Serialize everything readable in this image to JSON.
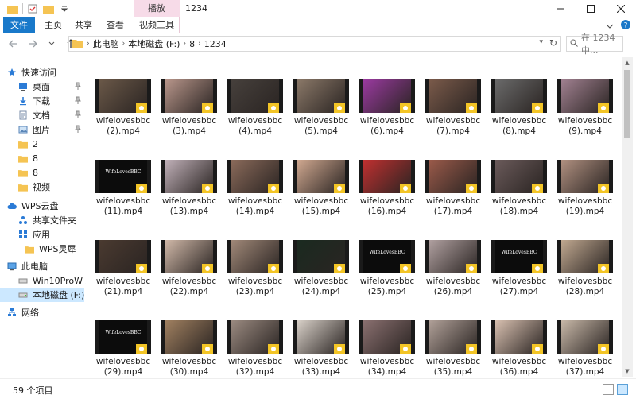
{
  "window": {
    "title": "1234",
    "context_tab": "播放"
  },
  "ribbon": {
    "tabs": [
      "文件",
      "主页",
      "共享",
      "查看",
      "视频工具"
    ]
  },
  "address": {
    "crumbs": [
      "此电脑",
      "本地磁盘 (F:)",
      "8",
      "1234"
    ],
    "search_placeholder": "在 1234 中..."
  },
  "sidebar": {
    "items": [
      {
        "label": "快速访问",
        "icon": "star-icon",
        "pinned": false
      },
      {
        "label": "桌面",
        "icon": "desktop-icon",
        "pinned": true
      },
      {
        "label": "下载",
        "icon": "download-icon",
        "pinned": true
      },
      {
        "label": "文档",
        "icon": "document-icon",
        "pinned": true
      },
      {
        "label": "图片",
        "icon": "pictures-icon",
        "pinned": true
      },
      {
        "label": "2",
        "icon": "folder-icon",
        "pinned": false
      },
      {
        "label": "8",
        "icon": "folder-icon",
        "pinned": false
      },
      {
        "label": "8",
        "icon": "folder-icon",
        "pinned": false
      },
      {
        "label": "视频",
        "icon": "folder-icon",
        "pinned": false
      },
      {
        "label": "WPS云盘",
        "icon": "cloud-icon",
        "pinned": false
      },
      {
        "label": "共享文件夹",
        "icon": "share-folder-icon",
        "pinned": false
      },
      {
        "label": "应用",
        "icon": "apps-icon",
        "pinned": false
      },
      {
        "label": "WPS灵犀",
        "icon": "folder-icon",
        "pinned": false
      },
      {
        "label": "此电脑",
        "icon": "computer-icon",
        "pinned": false
      },
      {
        "label": "Win10ProW X",
        "icon": "drive-icon",
        "pinned": false
      },
      {
        "label": "本地磁盘 (F:)",
        "icon": "drive-icon",
        "pinned": false
      },
      {
        "label": "网络",
        "icon": "network-icon",
        "pinned": false
      }
    ]
  },
  "files": [
    {
      "name": "wifelovesbbc (2).mp4",
      "color": "#6a5848"
    },
    {
      "name": "wifelovesbbc (3).mp4",
      "color": "#b7958a"
    },
    {
      "name": "wifelovesbbc (4).mp4",
      "color": "#46403c"
    },
    {
      "name": "wifelovesbbc (5).mp4",
      "color": "#8a7868"
    },
    {
      "name": "wifelovesbbc (6).mp4",
      "color": "#9a3aa0"
    },
    {
      "name": "wifelovesbbc (7).mp4",
      "color": "#7a5a4a"
    },
    {
      "name": "wifelovesbbc (8).mp4",
      "color": "#6a6a6a"
    },
    {
      "name": "wifelovesbbc (9).mp4",
      "color": "#a08090"
    },
    {
      "name": "wifelovesbbc (11).mp4",
      "color": "#111111",
      "logo": "WifeLovesBBC"
    },
    {
      "name": "wifelovesbbc (13).mp4",
      "color": "#c0b0b8"
    },
    {
      "name": "wifelovesbbc (14).mp4",
      "color": "#8a6a5a"
    },
    {
      "name": "wifelovesbbc (15).mp4",
      "color": "#d0a890"
    },
    {
      "name": "wifelovesbbc (16).mp4",
      "color": "#c03030"
    },
    {
      "name": "wifelovesbbc (17).mp4",
      "color": "#9a5a4a"
    },
    {
      "name": "wifelovesbbc (18).mp4",
      "color": "#6a5a5a"
    },
    {
      "name": "wifelovesbbc (19).mp4",
      "color": "#b09080"
    },
    {
      "name": "wifelovesbbc (21).mp4",
      "color": "#4a3a30"
    },
    {
      "name": "wifelovesbbc (22).mp4",
      "color": "#d0b8a8"
    },
    {
      "name": "wifelovesbbc (23).mp4",
      "color": "#a08878"
    },
    {
      "name": "wifelovesbbc (24).mp4",
      "color": "#1a2a20"
    },
    {
      "name": "wifelovesbbc (25).mp4",
      "color": "#111111",
      "logo": "WifeLovesBBC"
    },
    {
      "name": "wifelovesbbc (26).mp4",
      "color": "#b0a0a0"
    },
    {
      "name": "wifelovesbbc (27).mp4",
      "color": "#111111",
      "logo": "WifeLovesBBC"
    },
    {
      "name": "wifelovesbbc (28).mp4",
      "color": "#c0a890"
    },
    {
      "name": "wifelovesbbc (29).mp4",
      "color": "#111111",
      "logo": "WifeLovesBBC"
    },
    {
      "name": "wifelovesbbc (30).mp4",
      "color": "#a08060"
    },
    {
      "name": "wifelovesbbc (32).mp4",
      "color": "#9a8a80"
    },
    {
      "name": "wifelovesbbc (33).mp4",
      "color": "#d8d0c8"
    },
    {
      "name": "wifelovesbbc (34).mp4",
      "color": "#8a7070"
    },
    {
      "name": "wifelovesbbc (35).mp4",
      "color": "#b0a098"
    },
    {
      "name": "wifelovesbbc (36).mp4",
      "color": "#d8c0b0"
    },
    {
      "name": "wifelovesbbc (37).mp4",
      "color": "#c8b8a8"
    }
  ],
  "status": {
    "count": "59 个项目"
  }
}
